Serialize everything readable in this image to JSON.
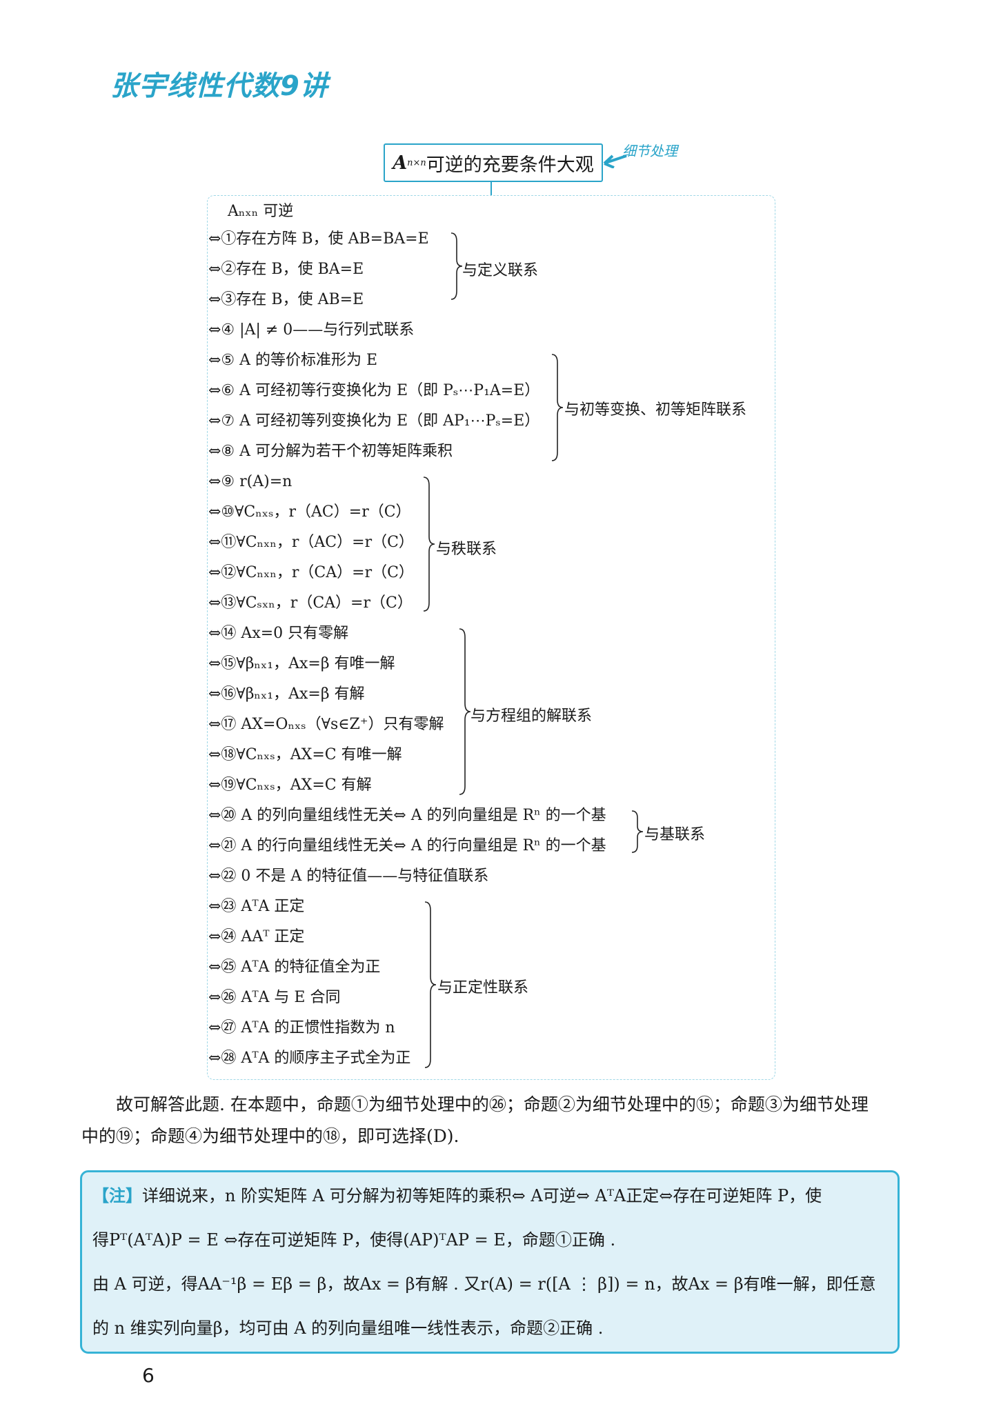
{
  "header": {
    "logo": "张宇线性代数9讲"
  },
  "title": {
    "symbol": "A",
    "subscript": "n×n",
    "text": "可逆的充要条件大观"
  },
  "annotation": "细节处理",
  "conditions": [
    {
      "id": "c0",
      "text": "Aₙₓₙ 可逆"
    },
    {
      "id": "c1",
      "text": "⇔①存在方阵 B，使 AB=BA=E"
    },
    {
      "id": "c2",
      "text": "⇔②存在 B，使 BA=E"
    },
    {
      "id": "c3",
      "text": "⇔③存在 B，使 AB=E"
    },
    {
      "id": "c4",
      "text": "⇔④ |A| ≠ 0——与行列式联系"
    },
    {
      "id": "c5",
      "text": "⇔⑤ A 的等价标准形为 E"
    },
    {
      "id": "c6",
      "text": "⇔⑥ A 可经初等行变换化为 E（即 Pₛ⋯P₁A=E）"
    },
    {
      "id": "c7",
      "text": "⇔⑦ A 可经初等列变换化为 E（即 AP₁⋯Pₛ=E）"
    },
    {
      "id": "c8",
      "text": "⇔⑧ A 可分解为若干个初等矩阵乘积"
    },
    {
      "id": "c9",
      "text": "⇔⑨ r(A)=n"
    },
    {
      "id": "c10",
      "text": "⇔⑩∀Cₙₓₛ，r（AC）=r（C）"
    },
    {
      "id": "c11",
      "text": "⇔⑪∀Cₙₓₙ，r（AC）=r（C）"
    },
    {
      "id": "c12",
      "text": "⇔⑫∀Cₙₓₙ，r（CA）=r（C）"
    },
    {
      "id": "c13",
      "text": "⇔⑬∀Cₛₓₙ，r（CA）=r（C）"
    },
    {
      "id": "c14",
      "text": "⇔⑭ Ax=0 只有零解"
    },
    {
      "id": "c15",
      "text": "⇔⑮∀βₙₓ₁，Ax=β 有唯一解"
    },
    {
      "id": "c16",
      "text": "⇔⑯∀βₙₓ₁，Ax=β 有解"
    },
    {
      "id": "c17",
      "text": "⇔⑰ AX=Oₙₓₛ（∀s∈Z⁺）只有零解"
    },
    {
      "id": "c18",
      "text": "⇔⑱∀Cₙₓₛ，AX=C 有唯一解"
    },
    {
      "id": "c19",
      "text": "⇔⑲∀Cₙₓₛ，AX=C 有解"
    },
    {
      "id": "c20",
      "text": "⇔⑳ A 的列向量组线性无关⇔ A 的列向量组是 Rⁿ 的一个基"
    },
    {
      "id": "c21",
      "text": "⇔㉑ A 的行向量组线性无关⇔ A 的行向量组是 Rⁿ 的一个基"
    },
    {
      "id": "c22",
      "text": "⇔㉒ 0 不是 A 的特征值——与特征值联系"
    },
    {
      "id": "c23",
      "text": "⇔㉓ AᵀA 正定"
    },
    {
      "id": "c24",
      "text": "⇔㉔ AAᵀ 正定"
    },
    {
      "id": "c25",
      "text": "⇔㉕ AᵀA 的特征值全为正"
    },
    {
      "id": "c26",
      "text": "⇔㉖ AᵀA 与 E 合同"
    },
    {
      "id": "c27",
      "text": "⇔㉗ AᵀA 的正惯性指数为 n"
    },
    {
      "id": "c28",
      "text": "⇔㉘ AᵀA 的顺序主子式全为正"
    }
  ],
  "groups": {
    "definition": "与定义联系",
    "elementary": "与初等变换、初等矩阵联系",
    "rank": "与秩联系",
    "equations": "与方程组的解联系",
    "basis": "与基联系",
    "positive": "与正定性联系"
  },
  "paragraph": {
    "line1": "故可解答此题. 在本题中，命题①为细节处理中的㉖；命题②为细节处理中的⑮；命题③为细节处理",
    "line2": "中的⑲；命题④为细节处理中的⑱，即可选择(D)."
  },
  "note": {
    "tag": "【注】",
    "line1": "详细说来，n 阶实矩阵 A 可分解为初等矩阵的乘积⇔ A可逆⇔ AᵀA正定⇔存在可逆矩阵 P，使",
    "line2": "得Pᵀ(AᵀA)P = E ⇔存在可逆矩阵 P，使得(AP)ᵀAP = E，命题①正确 .",
    "line3": "由 A 可逆，得AA⁻¹β = Eβ = β，故Ax = β有解 . 又r(A) = r([A ⋮ β]) = n，故Ax = β有唯一解，即任意",
    "line4": "的 n 维实列向量β，均可由 A 的列向量组唯一线性表示，命题②正确 ."
  },
  "page_number": "6"
}
